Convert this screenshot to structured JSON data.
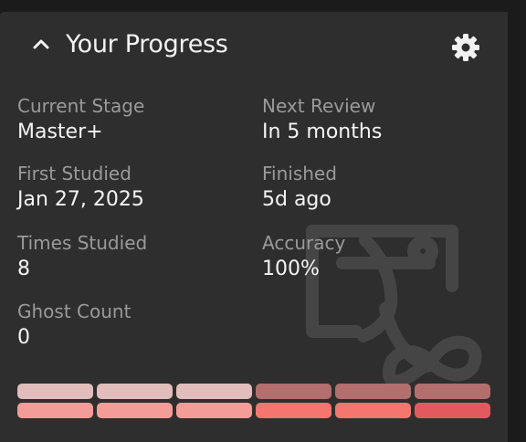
{
  "header": {
    "title": "Your Progress",
    "collapse_icon": "chevron-up-icon",
    "settings_icon": "gear-icon"
  },
  "stats": {
    "current_stage": {
      "label": "Current Stage",
      "value": "Master+"
    },
    "next_review": {
      "label": "Next Review",
      "value": "In 5 months"
    },
    "first_studied": {
      "label": "First Studied",
      "value": "Jan 27, 2025"
    },
    "finished": {
      "label": "Finished",
      "value": "5d ago"
    },
    "times_studied": {
      "label": "Times Studied",
      "value": "8"
    },
    "accuracy": {
      "label": "Accuracy",
      "value": "100%"
    },
    "ghost_count": {
      "label": "Ghost Count",
      "value": "0"
    }
  },
  "progress_bars": {
    "top_row": [
      "#e1bdbc",
      "#e1bdbc",
      "#e1bdbc",
      "#b36e6e",
      "#b36e6e",
      "#b36e6e"
    ],
    "bottom_row": [
      "#f49c97",
      "#f49c97",
      "#f49c97",
      "#f5766f",
      "#f5766f",
      "#e35a5e"
    ]
  },
  "colors": {
    "panel_bg": "#2e2e2e",
    "label": "#9a9a9a",
    "value": "#f4f4f4"
  }
}
